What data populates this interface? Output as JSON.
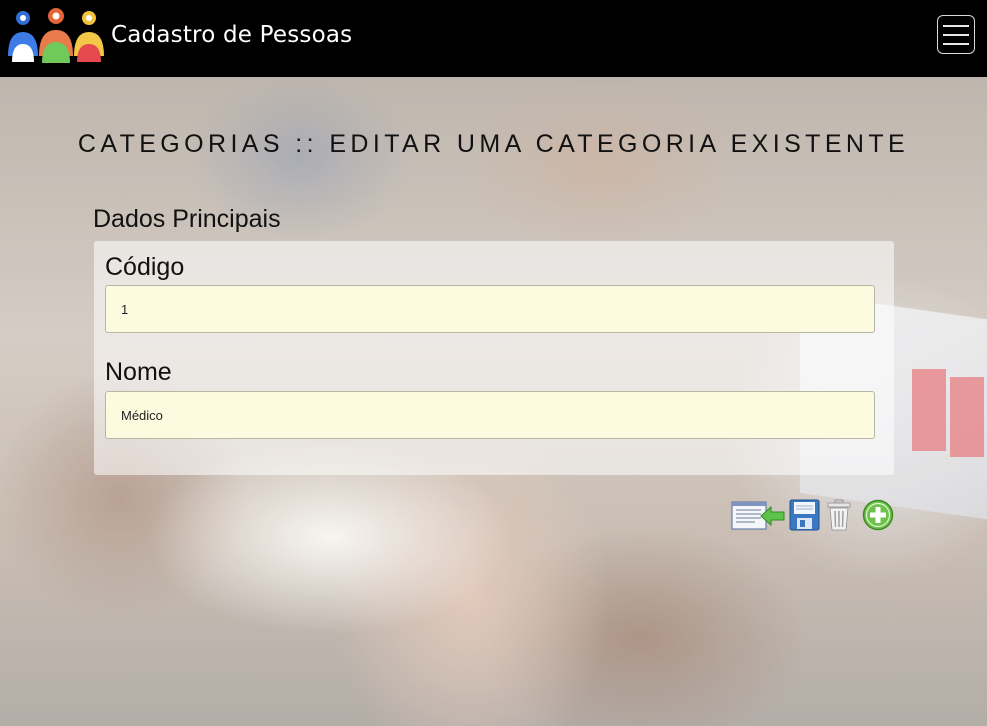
{
  "navbar": {
    "brand_title": "Cadastro de Pessoas",
    "logo_icon": "people-group-logo",
    "menu_icon": "hamburger-menu-icon"
  },
  "page": {
    "title": "CATEGORIAS :: EDITAR UMA CATEGORIA EXISTENTE",
    "section_title": "Dados Principais"
  },
  "form": {
    "codigo": {
      "label": "Código",
      "value": "1"
    },
    "nome": {
      "label": "Nome",
      "value": "Médico"
    }
  },
  "actions": {
    "back_icon": "back-to-list-icon",
    "save_icon": "save-disk-icon",
    "delete_icon": "trash-icon",
    "add_icon": "add-plus-icon"
  },
  "colors": {
    "navbar_bg": "#000000",
    "input_bg": "#fdfbdf",
    "add_green": "#6cc24a",
    "save_blue": "#3a78c2"
  }
}
